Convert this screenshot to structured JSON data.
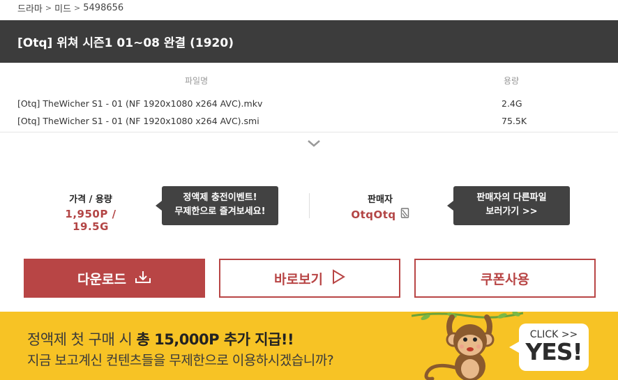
{
  "breadcrumb": {
    "items": [
      "드라마",
      "미드",
      "5498656"
    ]
  },
  "title": "[Otq] 위쳐 시즌1 01~08 완결 (1920)",
  "files": {
    "header_name": "파일명",
    "header_size": "용량",
    "rows": [
      {
        "name": "[Otq] TheWicher S1 - 01 (NF 1920x1080 x264 AVC).mkv",
        "size": "2.4G"
      },
      {
        "name": "[Otq] TheWicher S1 - 01 (NF 1920x1080 x264 AVC).smi",
        "size": "75.5K"
      }
    ]
  },
  "price": {
    "label": "가격 / 용량",
    "value": "1,950P / 19.5G"
  },
  "promo_tip": {
    "line1": "정액제 충전이벤트!",
    "line2": "무제한으로 즐겨보세요!"
  },
  "seller": {
    "label": "판매자",
    "name": "OtqOtq"
  },
  "seller_tip": {
    "line1": "판매자의 다른파일",
    "line2": "보러가기 >>"
  },
  "buttons": {
    "download": "다운로드",
    "view": "바로보기",
    "coupon": "쿠폰사용"
  },
  "banner": {
    "line1_pre": "정액제 첫 구매 시 ",
    "line1_bold": "총 15,000P 추가 지급!!",
    "line2": "지금 보고계신 컨텐츠들을 무제한으로 이용하시겠습니까?",
    "cta_small": "CLICK >>",
    "cta_big": "YES!"
  },
  "colors": {
    "accent": "#b84545",
    "title_bg": "#3c3c3c",
    "banner_bg": "#f7c325",
    "tooltip_bg": "#424242"
  },
  "icons": {
    "expand": "chevron-down-icon",
    "download": "download-icon",
    "view": "play-icon",
    "seller_badge": "seller-badge-icon"
  }
}
